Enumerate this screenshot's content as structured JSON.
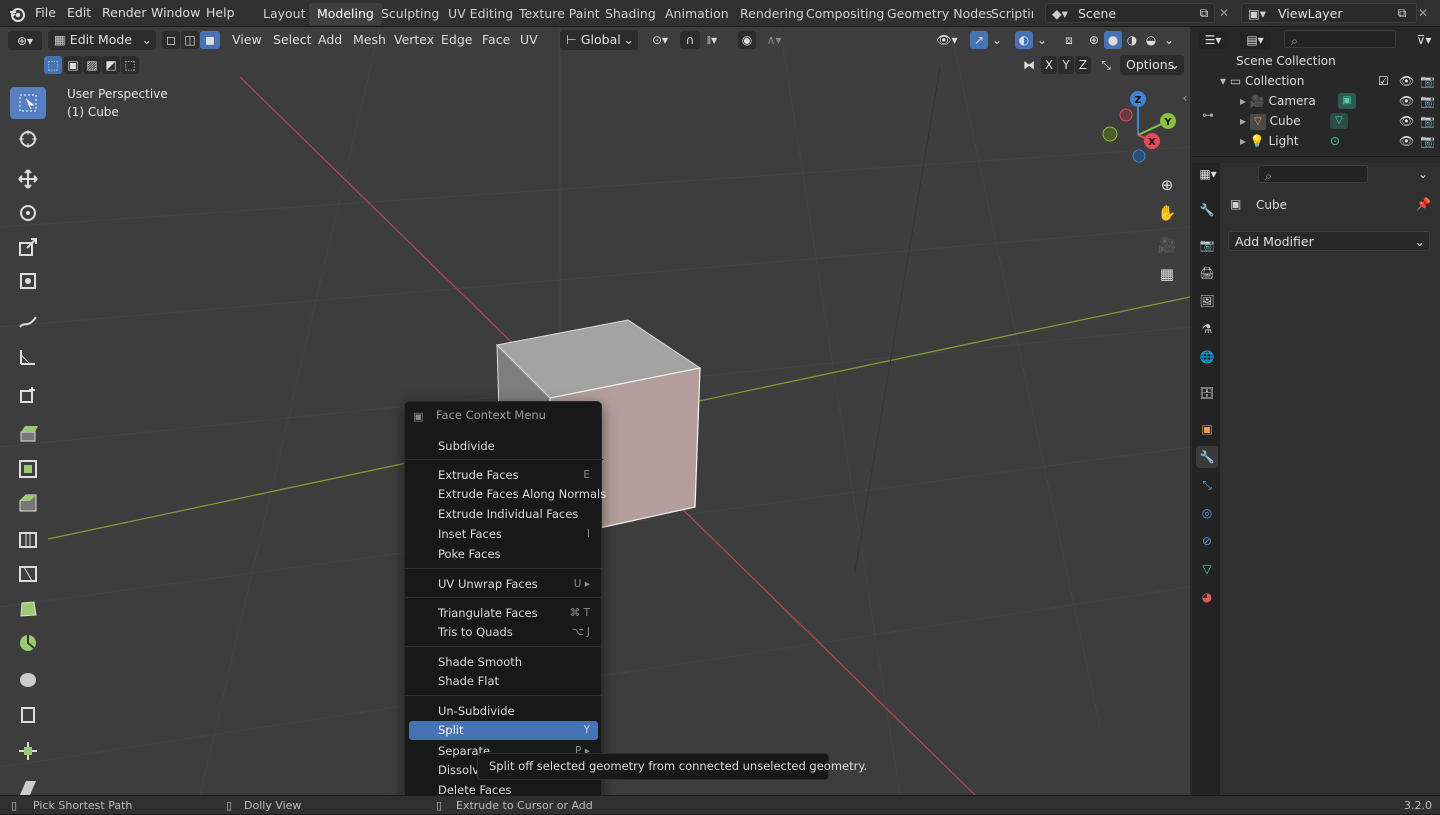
{
  "menu": {
    "file": "File",
    "edit": "Edit",
    "render": "Render",
    "window": "Window",
    "help": "Help"
  },
  "workspaces": [
    {
      "label": "Layout",
      "active": false
    },
    {
      "label": "Modeling",
      "active": true
    },
    {
      "label": "Sculpting",
      "active": false
    },
    {
      "label": "UV Editing",
      "active": false
    },
    {
      "label": "Texture Paint",
      "active": false
    },
    {
      "label": "Shading",
      "active": false
    },
    {
      "label": "Animation",
      "active": false
    },
    {
      "label": "Rendering",
      "active": false
    },
    {
      "label": "Compositing",
      "active": false
    },
    {
      "label": "Geometry Nodes",
      "active": false
    },
    {
      "label": "Scripting",
      "active": false
    }
  ],
  "scene": {
    "name": "Scene"
  },
  "view_layer": {
    "name": "ViewLayer"
  },
  "viewport_header": {
    "mode": "Edit Mode",
    "view": "View",
    "select": "Select",
    "add": "Add",
    "mesh": "Mesh",
    "vertex": "Vertex",
    "edge": "Edge",
    "face": "Face",
    "uv": "UV",
    "orientation": "Global",
    "axis_x": "X",
    "axis_y": "Y",
    "axis_z": "Z",
    "options": "Options"
  },
  "viewport_overlay": {
    "perspective": "User Perspective",
    "object": "(1) Cube"
  },
  "gizmo": {
    "x": "X",
    "y": "Y",
    "z": "Z"
  },
  "context_menu": {
    "title": "Face Context Menu",
    "items": [
      {
        "label": "Subdivide",
        "shortcut": ""
      },
      {
        "label": "Extrude Faces",
        "shortcut": "E"
      },
      {
        "label": "Extrude Faces Along Normals",
        "shortcut": ""
      },
      {
        "label": "Extrude Individual Faces",
        "shortcut": ""
      },
      {
        "label": "Inset Faces",
        "shortcut": "I"
      },
      {
        "label": "Poke Faces",
        "shortcut": ""
      },
      {
        "label": "UV Unwrap Faces",
        "shortcut": "U ▸"
      },
      {
        "label": "Triangulate Faces",
        "shortcut": "⌘ T"
      },
      {
        "label": "Tris to Quads",
        "shortcut": "⌥ J"
      },
      {
        "label": "Shade Smooth",
        "shortcut": ""
      },
      {
        "label": "Shade Flat",
        "shortcut": ""
      },
      {
        "label": "Un-Subdivide",
        "shortcut": ""
      },
      {
        "label": "Split",
        "shortcut": "Y"
      },
      {
        "label": "Separate",
        "shortcut": "P ▸"
      },
      {
        "label": "Dissolve",
        "shortcut": ""
      },
      {
        "label": "Delete Faces",
        "shortcut": ""
      }
    ]
  },
  "tooltip": "Split off selected geometry from connected unselected geometry.",
  "status_bar": {
    "left": "Pick Shortest Path",
    "middle": "Dolly View",
    "right": "Extrude to Cursor or Add",
    "version": "3.2.0"
  },
  "outliner": {
    "root": "Scene Collection",
    "collection": "Collection",
    "objects": [
      {
        "label": "Camera"
      },
      {
        "label": "Cube"
      },
      {
        "label": "Light"
      }
    ]
  },
  "properties": {
    "object_name": "Cube",
    "add_modifier": "Add Modifier"
  },
  "colors": {
    "accent": "#4772b3",
    "x_axis": "#e74a5b",
    "y_axis": "#8cbf3f",
    "z_axis": "#3d85d8",
    "viewport_bg": "#3d3d3d"
  }
}
